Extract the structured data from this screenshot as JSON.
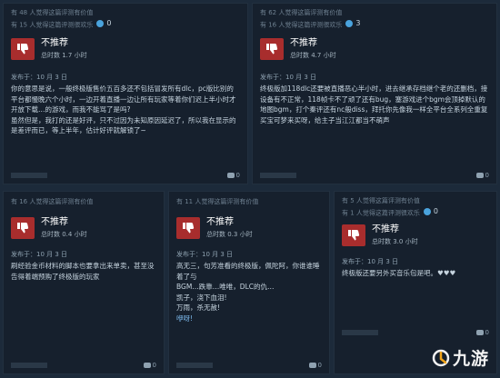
{
  "reviews": [
    {
      "helpful_lines": [
        "有 48 人觉得这篇评测有价值",
        "有 15 人觉得这篇评测很欢乐"
      ],
      "award": "0",
      "recommendation": "不推荐",
      "hours": "总时数 1.7 小时",
      "date": "发布于：10 月 3 日",
      "paragraphs": [
        "你的意思是说，一般终极版售价五百多还不包括冒发所有dlc，pc版比别的平台都慢晚六个小时，一边开着直播一边让所有玩家等着你们迟上半小时才开放下载…的游戏，而我不能骂了是吗?",
        "虽然但是，我打的还是好评，只不过因为未知原因延迟了，所以我在显示的是差评而已，等上半年，估计好评就解锁了~"
      ],
      "comments": "0"
    },
    {
      "helpful_lines": [
        "有 62 人觉得这篇评测有价值",
        "有 16 人觉得这篇评测很欢乐"
      ],
      "award": "3",
      "recommendation": "不推荐",
      "hours": "总时数 4.7 小时",
      "date": "发布于：10 月 3 日",
      "paragraphs": [
        "终极版加118dlc还要被直播恶心半小时，进去继承存档继个老的还删档，接设备有不正常，118帧卡不了顽了还有bug，塞游戏进个bgm会顶掉默认的地图bgm，打个秦评还有nc般diss，拜托你先像我一样全平台全系列全重复买宝可梦来买呀，给主子当江江都当不萌声"
      ],
      "comments": "0"
    },
    {
      "helpful_lines": [
        "有 16 人觉得这篇评测有价值"
      ],
      "award": "",
      "recommendation": "不推荐",
      "hours": "总时数 0.4 小时",
      "date": "发布于：10 月 3 日",
      "paragraphs": [
        "刷经验金币材料的脚本也要拿出来单卖，甚至没告得着端预购了终极版的玩家"
      ],
      "comments": "0"
    },
    {
      "helpful_lines": [
        "有 11 人觉得这篇评测有价值"
      ],
      "award": "",
      "recommendation": "不推荐",
      "hours": "总时数 0.3 小时",
      "date": "发布于：10 月 3 日",
      "paragraphs": [
        "高无三，句芳准看的终极版，佩陀阿，你谁谁睡着了与",
        "BGM…跌靠…唯唯，DLC的仇…",
        "凯子，浇下血泪!",
        "万雨，杀无赦!",
        "咿呀!"
      ],
      "emph_index": 4,
      "comments": "0"
    },
    {
      "helpful_lines": [
        "有 5 人觉得这篇评测有价值",
        "有 1 人觉得这篇评测很欢乐"
      ],
      "award": "0",
      "recommendation": "不推荐",
      "hours": "总时数 3.0 小时",
      "date": "发布于：10 月 3 日",
      "paragraphs": [
        "终极版还要另外买音乐包是吧。♥♥♥"
      ],
      "comments": "0"
    }
  ],
  "watermark": {
    "text": "九游"
  }
}
